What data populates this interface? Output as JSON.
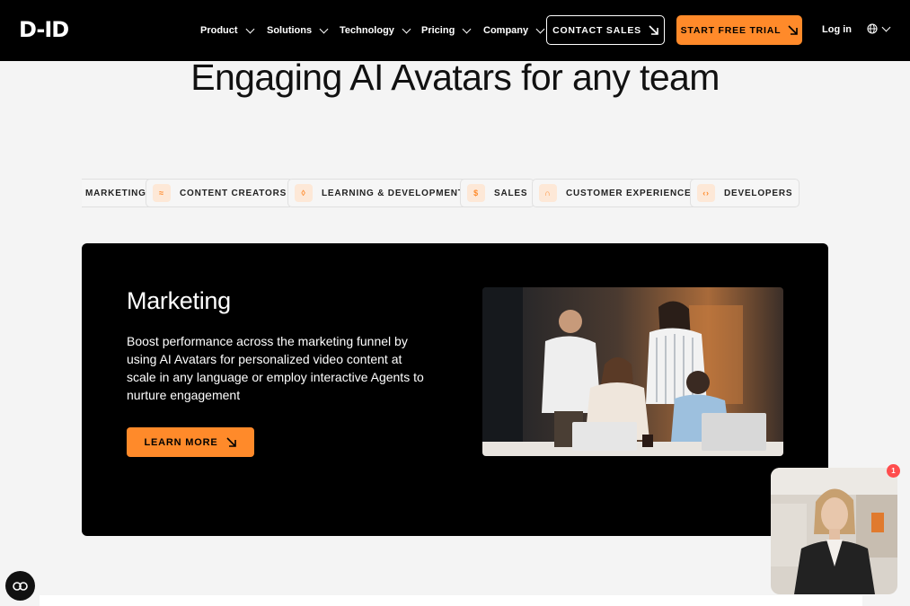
{
  "nav": {
    "logo_text": "D-ID",
    "items": [
      {
        "label": "Product"
      },
      {
        "label": "Solutions"
      },
      {
        "label": "Technology"
      },
      {
        "label": "Pricing"
      },
      {
        "label": "Company"
      }
    ],
    "contact_label": "CONTACT SALES",
    "trial_label": "START FREE TRIAL",
    "login_label": "Log in",
    "lang_icon": "globe-icon"
  },
  "hero": {
    "title": "Engaging AI Avatars for any team"
  },
  "chips": [
    {
      "label": "MARKETING",
      "icon": "megaphone-icon"
    },
    {
      "label": "CONTENT CREATORS",
      "icon": "pen-icon"
    },
    {
      "label": "LEARNING & DEVELOPMENT",
      "icon": "book-icon"
    },
    {
      "label": "SALES",
      "icon": "dollar-icon"
    },
    {
      "label": "CUSTOMER EXPERIENCE",
      "icon": "headset-icon"
    },
    {
      "label": "DEVELOPERS",
      "icon": "code-icon"
    }
  ],
  "card": {
    "title": "Marketing",
    "description": "Boost performance across the marketing funnel by using AI Avatars for personalized video content at scale in any language or employ interactive Agents to nurture engagement",
    "button_label": "LEARN MORE"
  },
  "widget": {
    "notification_count": "1"
  },
  "colors": {
    "accent": "#ff8a2a",
    "nav_bg": "#000000",
    "page_bg": "#f4f4f4"
  }
}
